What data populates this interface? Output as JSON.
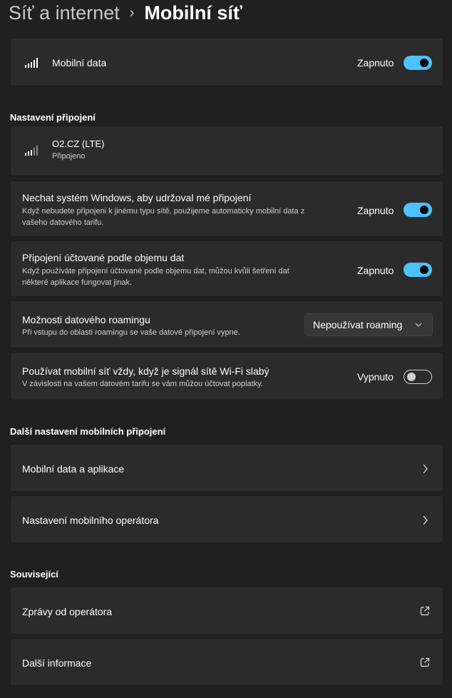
{
  "breadcrumb": {
    "parent": "Síť a internet",
    "separator": "›",
    "current": "Mobilní síť"
  },
  "mobile_data": {
    "label": "Mobilní data",
    "state_label": "Zapnuto",
    "enabled": true,
    "icon": "signal-bars-icon"
  },
  "connection_settings": {
    "heading": "Nastavení připojení",
    "network": {
      "name": "O2.CZ (LTE)",
      "status": "Připojeno",
      "icon": "signal-bars-icon"
    },
    "keep_connected": {
      "title": "Nechat systém Windows, aby udržoval mé připojení",
      "desc_line1": "Když nebudete připojeni k jinému typu sítě, použijeme automaticky mobilní data z",
      "desc_line2": "vašeho datového tarifu.",
      "state_label": "Zapnuto",
      "enabled": true
    },
    "metered": {
      "title": "Připojení účtované podle objemu dat",
      "desc_line1": "Když používáte připojení účtované podle objemu dat, můžou kvůli šetření dat",
      "desc_line2": "některé aplikace fungovat jinak.",
      "state_label": "Zapnuto",
      "enabled": true
    },
    "roaming": {
      "title": "Možnosti datového roamingu",
      "desc": "Při vstupu do oblasti roamingu se vaše datové připojení vypne.",
      "selected": "Nepoužívat roaming"
    },
    "weak_wifi": {
      "title": "Používat mobilní síť vždy, když je signál sítě Wi-Fi slabý",
      "desc": "V závislosti na vašem datovém tarifu se vám můžou účtovat poplatky.",
      "state_label": "Vypnuto",
      "enabled": false
    }
  },
  "more_settings": {
    "heading": "Další nastavení mobilních připojení",
    "items": [
      {
        "label": "Mobilní data a aplikace",
        "icon": "chevron-right-icon"
      },
      {
        "label": "Nastavení mobilního operátora",
        "icon": "chevron-right-icon"
      }
    ]
  },
  "related": {
    "heading": "Související",
    "items": [
      {
        "label": "Zprávy od operátora",
        "icon": "external-link-icon"
      },
      {
        "label": "Další informace",
        "icon": "external-link-icon"
      }
    ]
  },
  "colors": {
    "background": "#202020",
    "card": "#2b2b2b",
    "accent": "#4cc2ff"
  }
}
